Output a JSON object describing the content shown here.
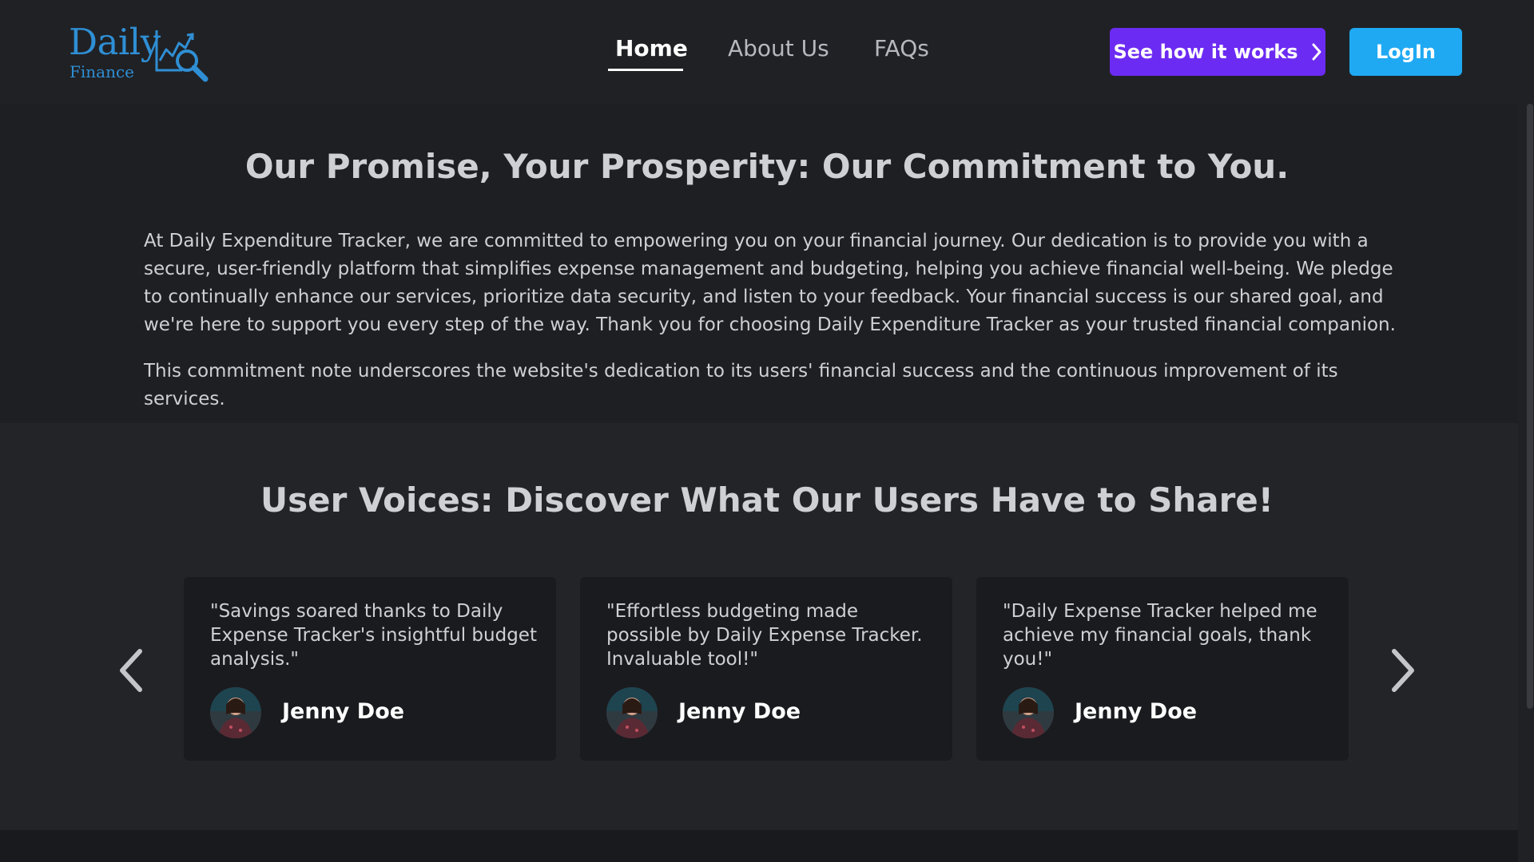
{
  "header": {
    "logo_title": "Daily",
    "logo_subtitle": "Finance",
    "nav": [
      {
        "label": "Home",
        "active": true
      },
      {
        "label": "About Us",
        "active": false
      },
      {
        "label": "FAQs",
        "active": false
      }
    ],
    "how_button_label": "See how it works",
    "how_button_icon": "chevron-right-icon",
    "login_button_label": "LogIn"
  },
  "promise": {
    "title": "Our Promise, Your Prosperity: Our Commitment to You.",
    "body": "At Daily Expenditure Tracker, we are committed to empowering you on your financial journey. Our dedication is to provide you with a secure, user-friendly platform that simplifies expense management and budgeting, helping you achieve financial well-being. We pledge to continually enhance our services, prioritize data security, and listen to your feedback. Your financial success is our shared goal, and we're here to support you every step of the way. Thank you for choosing Daily Expenditure Tracker as your trusted financial companion.",
    "note": "This commitment note underscores the website's dedication to its users' financial success and the continuous improvement of its services."
  },
  "voices": {
    "title": "User Voices: Discover What Our Users Have to Share!",
    "prev_icon": "chevron-left-icon",
    "next_icon": "chevron-right-icon",
    "testimonials": [
      {
        "quote": "\"Savings soared thanks to Daily Expense Tracker's insightful budget analysis.\"",
        "name": "Jenny Doe"
      },
      {
        "quote": "\"Effortless budgeting made possible by Daily Expense Tracker. Invaluable tool!\"",
        "name": "Jenny Doe"
      },
      {
        "quote": "\"Daily Expense Tracker helped me achieve my financial goals, thank you!\"",
        "name": "Jenny Doe"
      }
    ]
  },
  "colors": {
    "brand_blue": "#2f8fd4",
    "cta_purple": "#6c2bf2",
    "login_blue": "#1fa9f3",
    "background": "#1c1d21"
  }
}
